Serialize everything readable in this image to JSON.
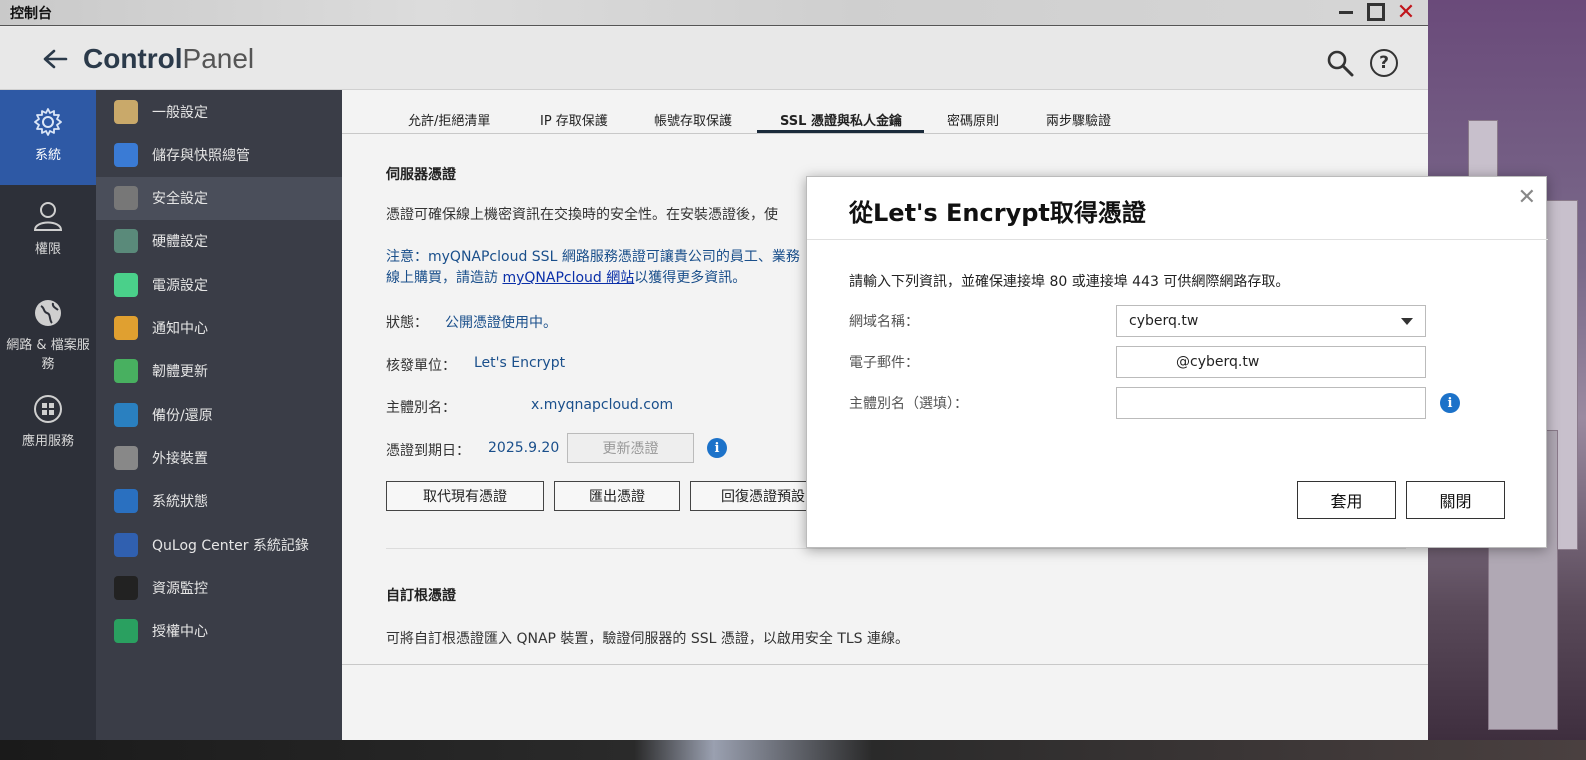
{
  "window": {
    "title": "控制台"
  },
  "header": {
    "app_title_bold": "Control",
    "app_title_light": "Panel"
  },
  "leftnav": [
    {
      "label": "系統",
      "icon": "gear-icon"
    },
    {
      "label": "權限",
      "icon": "user-icon"
    },
    {
      "label": "網路 & 檔案服務",
      "icon": "globe-icon"
    },
    {
      "label": "應用服務",
      "icon": "apps-icon"
    }
  ],
  "submenu": [
    {
      "label": "一般設定",
      "color": "#c9a96a"
    },
    {
      "label": "儲存與快照總管",
      "color": "#3a7bd5"
    },
    {
      "label": "安全設定",
      "color": "#777777"
    },
    {
      "label": "硬體設定",
      "color": "#5a8a7a"
    },
    {
      "label": "電源設定",
      "color": "#4ad08a"
    },
    {
      "label": "通知中心",
      "color": "#e0a030"
    },
    {
      "label": "韌體更新",
      "color": "#48b060"
    },
    {
      "label": "備份/還原",
      "color": "#2a80c0"
    },
    {
      "label": "外接裝置",
      "color": "#888888"
    },
    {
      "label": "系統狀態",
      "color": "#2a70c0"
    },
    {
      "label": "QuLog Center 系統記錄",
      "color": "#3060b0"
    },
    {
      "label": "資源監控",
      "color": "#222222"
    },
    {
      "label": "授權中心",
      "color": "#2aa060"
    }
  ],
  "tabs": [
    "允許/拒絕清單",
    "IP 存取保護",
    "帳號存取保護",
    "SSL 憑證與私人金鑰",
    "密碼原則",
    "兩步驟驗證"
  ],
  "content": {
    "server_cert_title": "伺服器憑證",
    "desc": "憑證可確保線上機密資訊在交換時的安全性。在安裝憑證後，使",
    "note_line1": "注意：myQNAPcloud SSL 網路服務憑證可讓貴公司的員工、業務",
    "note_line2_prefix": "線上購買，請造訪 ",
    "note_link": "myQNAPcloud 網站",
    "note_line2_suffix": "以獲得更多資訊。",
    "status_label": "狀態：",
    "status_value": "公開憑證使用中。",
    "issuer_label": "核發單位：",
    "issuer_value": "Let's Encrypt",
    "alias_label": "主體別名：",
    "alias_value": "x.myqnapcloud.com",
    "expiry_label": "憑證到期日：",
    "expiry_value": "2025.9.20",
    "renew_button": "更新憑證",
    "replace_button": "取代現有憑證",
    "export_button": "匯出憑證",
    "restore_button": "回復憑證預設",
    "root_cert_title": "自訂根憑證",
    "root_cert_desc": "可將自訂根憑證匯入 QNAP 裝置，驗證伺服器的 SSL 憑證，以啟用安全 TLS 連線。"
  },
  "dialog": {
    "title": "從Let's Encrypt取得憑證",
    "description": "請輸入下列資訊，並確保連接埠 80 或連接埠 443 可供網際網路存取。",
    "domain_label": "網域名稱：",
    "domain_value": "cyberq.tw",
    "email_label": "電子郵件：",
    "email_value": "@cyberq.tw",
    "alias_label": "主體別名（選填）：",
    "alias_value": "",
    "apply_button": "套用",
    "close_button": "關閉"
  }
}
